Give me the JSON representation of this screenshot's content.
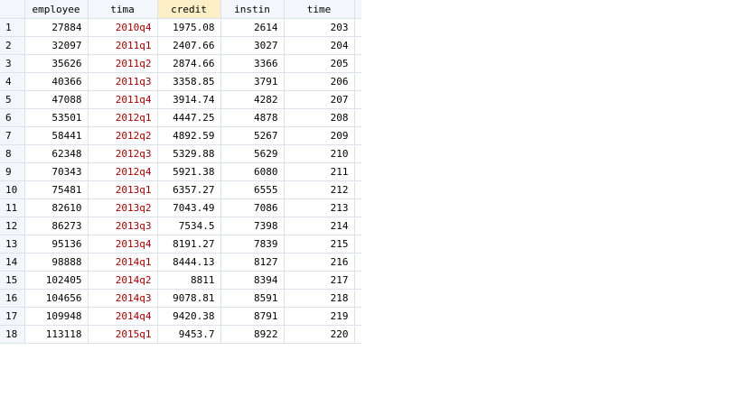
{
  "grid": {
    "columns": [
      {
        "key": "employee",
        "label": "employee",
        "type": "num"
      },
      {
        "key": "tima",
        "label": "tima",
        "type": "str"
      },
      {
        "key": "credit",
        "label": "credit",
        "type": "num",
        "selected": true
      },
      {
        "key": "instin",
        "label": "instin",
        "type": "num"
      },
      {
        "key": "time",
        "label": "time",
        "type": "num"
      }
    ],
    "rows": [
      [
        "1",
        "27884",
        "2010q4",
        "1975.08",
        "2614",
        "203"
      ],
      [
        "2",
        "32097",
        "2011q1",
        "2407.66",
        "3027",
        "204"
      ],
      [
        "3",
        "35626",
        "2011q2",
        "2874.66",
        "3366",
        "205"
      ],
      [
        "4",
        "40366",
        "2011q3",
        "3358.85",
        "3791",
        "206"
      ],
      [
        "5",
        "47088",
        "2011q4",
        "3914.74",
        "4282",
        "207"
      ],
      [
        "6",
        "53501",
        "2012q1",
        "4447.25",
        "4878",
        "208"
      ],
      [
        "7",
        "58441",
        "2012q2",
        "4892.59",
        "5267",
        "209"
      ],
      [
        "8",
        "62348",
        "2012q3",
        "5329.88",
        "5629",
        "210"
      ],
      [
        "9",
        "70343",
        "2012q4",
        "5921.38",
        "6080",
        "211"
      ],
      [
        "10",
        "75481",
        "2013q1",
        "6357.27",
        "6555",
        "212"
      ],
      [
        "11",
        "82610",
        "2013q2",
        "7043.49",
        "7086",
        "213"
      ],
      [
        "12",
        "86273",
        "2013q3",
        "7534.5",
        "7398",
        "214"
      ],
      [
        "13",
        "95136",
        "2013q4",
        "8191.27",
        "7839",
        "215"
      ],
      [
        "14",
        "98888",
        "2014q1",
        "8444.13",
        "8127",
        "216"
      ],
      [
        "15",
        "102405",
        "2014q2",
        "8811",
        "8394",
        "217"
      ],
      [
        "16",
        "104656",
        "2014q3",
        "9078.81",
        "8591",
        "218"
      ],
      [
        "17",
        "109948",
        "2014q4",
        "9420.38",
        "8791",
        "219"
      ],
      [
        "18",
        "113118",
        "2015q1",
        "9453.7",
        "8922",
        "220"
      ]
    ],
    "colors": {
      "string_text": "#a00000",
      "header_bg": "#f3f6fb",
      "selected_header_bg": "#fcefc8",
      "grid_line": "#dbe2ee"
    }
  }
}
